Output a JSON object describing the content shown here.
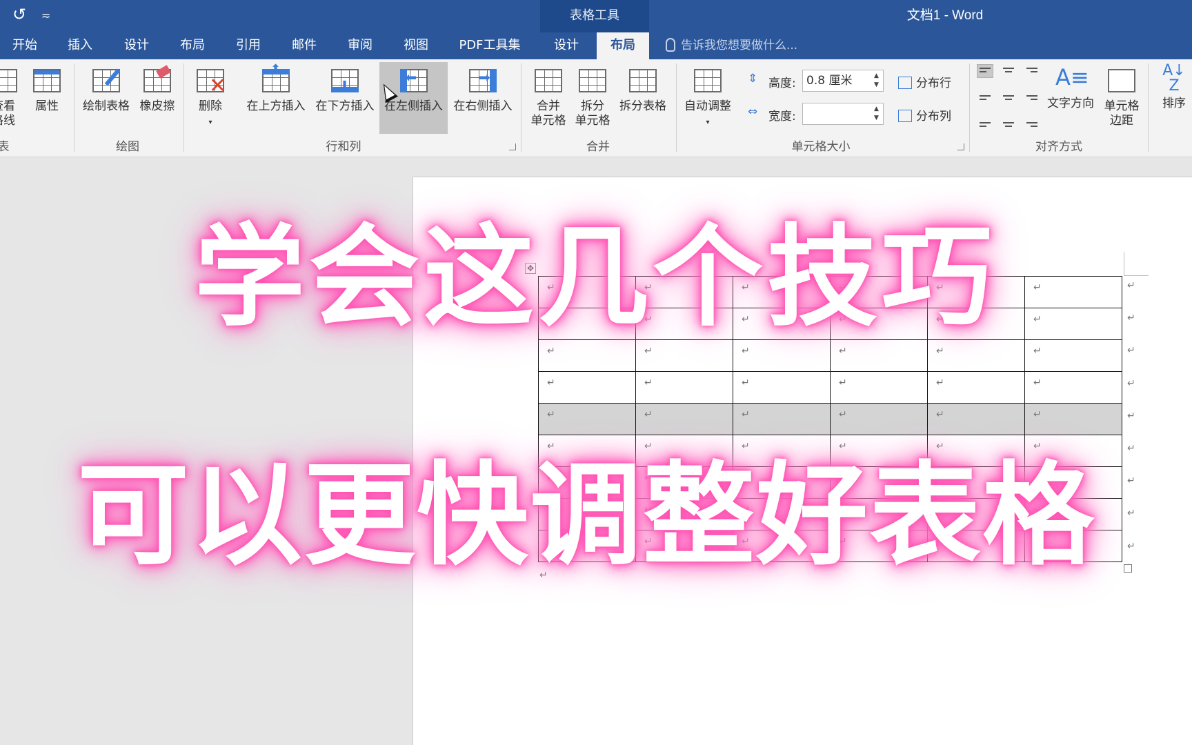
{
  "window": {
    "title": "文档1 - Word",
    "context_tab_group": "表格工具"
  },
  "qat": {
    "undo_icon": "undo-icon",
    "customize_icon": "customize-qat-icon"
  },
  "tabs": [
    {
      "label": "开始"
    },
    {
      "label": "插入"
    },
    {
      "label": "设计"
    },
    {
      "label": "布局"
    },
    {
      "label": "引用"
    },
    {
      "label": "邮件"
    },
    {
      "label": "审阅"
    },
    {
      "label": "视图"
    },
    {
      "label": "PDF工具集"
    },
    {
      "label": "设计"
    },
    {
      "label": "布局",
      "active": true
    }
  ],
  "tell_me": "告诉我您想要做什么...",
  "ribbon": {
    "table_group": {
      "view_gridlines_1": "查看",
      "view_gridlines_2": "格线",
      "properties": "属性",
      "label": "表"
    },
    "draw_group": {
      "draw_table": "绘制表格",
      "eraser": "橡皮擦",
      "label": "绘图"
    },
    "rows_cols_group": {
      "delete": "删除",
      "insert_above": "在上方插入",
      "insert_below": "在下方插入",
      "insert_left": "在左侧插入",
      "insert_right": "在右侧插入",
      "label": "行和列"
    },
    "merge_group": {
      "merge_cells_1": "合并",
      "merge_cells_2": "单元格",
      "split_cells_1": "拆分",
      "split_cells_2": "单元格",
      "split_table": "拆分表格",
      "label": "合并"
    },
    "cell_size_group": {
      "autofit": "自动调整",
      "height_label": "高度:",
      "height_value": "0.8 厘米",
      "width_label": "宽度:",
      "width_value": "",
      "distribute_rows": "分布行",
      "distribute_cols": "分布列",
      "label": "单元格大小"
    },
    "alignment_group": {
      "text_direction": "文字方向",
      "cell_margins_1": "单元格",
      "cell_margins_2": "边距",
      "label": "对齐方式"
    },
    "data_group": {
      "sort": "排序"
    }
  },
  "document": {
    "table": {
      "rows": 9,
      "cols": 6,
      "cell_mark": "↵",
      "highlighted_row": 4
    },
    "paragraph_mark": "↵"
  },
  "overlay": {
    "line1": "学会这几个技巧",
    "line2": "可以更快调整好表格",
    "glow_color": "#ff4fb0"
  },
  "colors": {
    "accent": "#2b579a",
    "ribbon_bg": "#f3f3f3",
    "page_bg": "#ffffff",
    "workspace_bg": "#e6e6e6"
  }
}
